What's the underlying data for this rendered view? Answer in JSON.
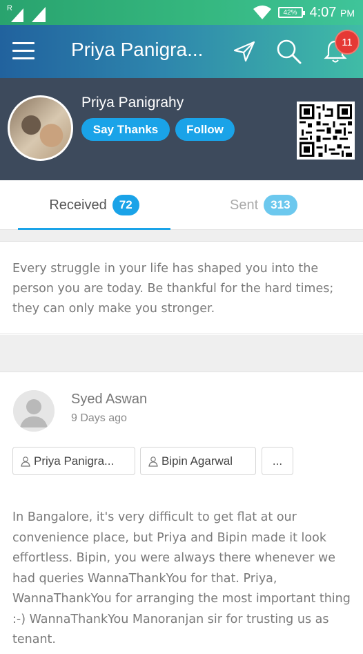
{
  "status_bar": {
    "signal_label": "R",
    "battery": "42%",
    "time": "4:07",
    "ampm": "PM",
    "icons": [
      "signal-icon",
      "signal-icon",
      "wifi-icon",
      "battery-icon"
    ]
  },
  "app_bar": {
    "title": "Priya Panigra...",
    "notification_count": "11",
    "icons": [
      "menu-icon",
      "send-icon",
      "search-icon",
      "bell-icon"
    ]
  },
  "profile": {
    "name": "Priya Panigrahy",
    "say_thanks_label": "Say Thanks",
    "follow_label": "Follow"
  },
  "tabs": [
    {
      "label": "Received",
      "count": "72",
      "active": true
    },
    {
      "label": "Sent",
      "count": "313",
      "active": false
    }
  ],
  "quote": {
    "text": "Every struggle in your life has shaped you into the person you are today. Be thankful for the hard times; they can only make you stronger."
  },
  "post": {
    "author": "Syed Aswan",
    "time": "9 Days ago",
    "recipients": [
      "Priya Panigra...",
      "Bipin Agarwal"
    ],
    "more_label": "...",
    "body": "In Bangalore, it's very difficult to get flat at our convenience place, but Priya and Bipin made it look effortless. Bipin, you were always there whenever we had queries WannaThankYou for that. Priya, WannaThankYou for arranging the most important thing :-) WannaThankYou Manoranjan sir for trusting us as tenant."
  },
  "colors": {
    "accent": "#1aa3e8",
    "profile_bg": "#3d4a5c",
    "badge": "#e53935"
  }
}
